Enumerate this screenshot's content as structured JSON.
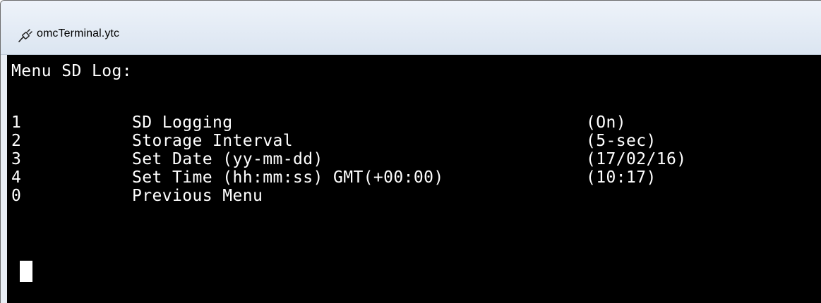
{
  "window": {
    "title": "omcTerminal.ytc",
    "icon": "telnet-plug-icon"
  },
  "terminal": {
    "menu_title": "Menu SD Log:",
    "options": [
      {
        "key": "1",
        "label": "SD Logging",
        "value": "(On)"
      },
      {
        "key": "2",
        "label": "Storage Interval",
        "value": "(5-sec)"
      },
      {
        "key": "3",
        "label": "Set Date (yy-mm-dd)",
        "value": "(17/02/16)"
      },
      {
        "key": "4",
        "label": "Set Time (hh:mm:ss) GMT(+00:00)",
        "value": "(10:17)"
      },
      {
        "key": "0",
        "label": "Previous Menu",
        "value": ""
      }
    ],
    "colors": {
      "background": "#000000",
      "foreground": "#ffffff"
    }
  }
}
